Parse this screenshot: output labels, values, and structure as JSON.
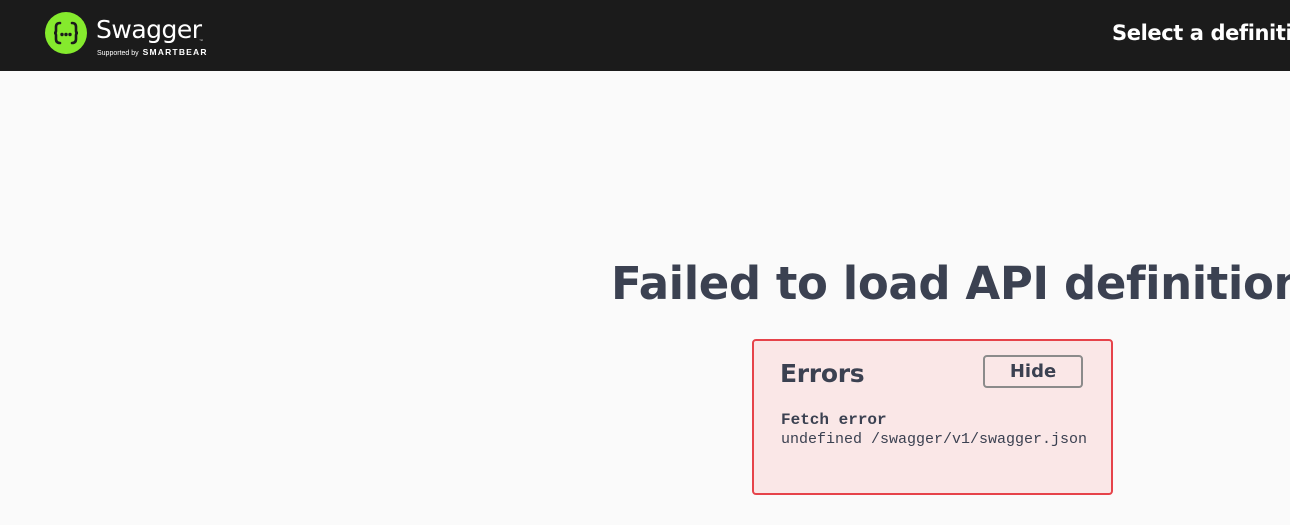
{
  "header": {
    "brand_name": "Swagger",
    "brand_tm": "™",
    "brand_supported_by": "Supported by",
    "brand_company": "SMARTBEAR",
    "logo_icon": "swagger-braces-icon",
    "select_definition_label": "Select a definition"
  },
  "main": {
    "title": "Failed to load API definition."
  },
  "errors": {
    "title": "Errors",
    "hide_label": "Hide",
    "items": [
      {
        "source": "Fetch error",
        "message": "undefined /swagger/v1/swagger.json"
      }
    ]
  },
  "colors": {
    "topbar": "#1b1b1b",
    "logo_green": "#85ea2d",
    "page_bg": "#fafafa",
    "text": "#3b4151",
    "error_bg": "#fae7e7",
    "error_border": "#e6434a"
  }
}
